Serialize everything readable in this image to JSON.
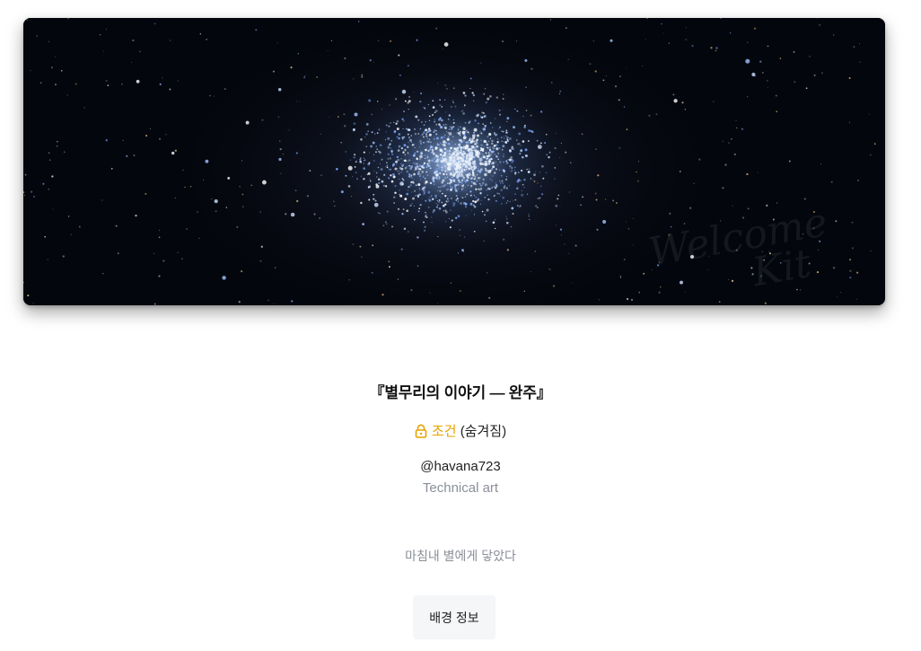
{
  "banner": {
    "watermark_line1": "Welcome",
    "watermark_line2": "Kit"
  },
  "entry": {
    "title": "『별무리의 이야기 — 완주』",
    "condition_label": "조건",
    "condition_state": "(숨겨짐)",
    "handle": "@havana723",
    "role": "Technical art",
    "quote": "마침내 별에게 닿았다"
  },
  "actions": {
    "background_info_label": "배경 정보"
  },
  "colors": {
    "accent": "#e6a100",
    "muted": "#8a8f98",
    "banner_bg": "#04060d"
  },
  "icons": {
    "condition": "lock-icon"
  }
}
